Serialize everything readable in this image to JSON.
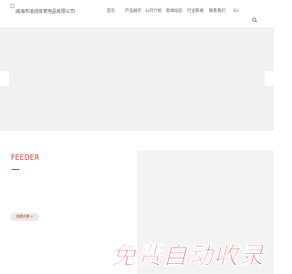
{
  "header": {
    "company_name": "威海市凌动体育用品有限公司",
    "nav": [
      {
        "label": "首页"
      },
      {
        "label": "产品展示"
      },
      {
        "label": "公司介绍"
      },
      {
        "label": "新闻动态"
      },
      {
        "label": "行业新闻"
      },
      {
        "label": "联系我们"
      },
      {
        "label": "En"
      }
    ],
    "search_icon": "search-icon"
  },
  "banner": {
    "left_arrow_icon": "chevron-left-icon",
    "right_arrow_icon": "chevron-right-icon"
  },
  "product": {
    "title": "FEEDER",
    "more_label": "查看详情 >",
    "accent_color": "#d12e26"
  },
  "watermark": {
    "text": "免费自动收录",
    "color": "#d41f26"
  }
}
